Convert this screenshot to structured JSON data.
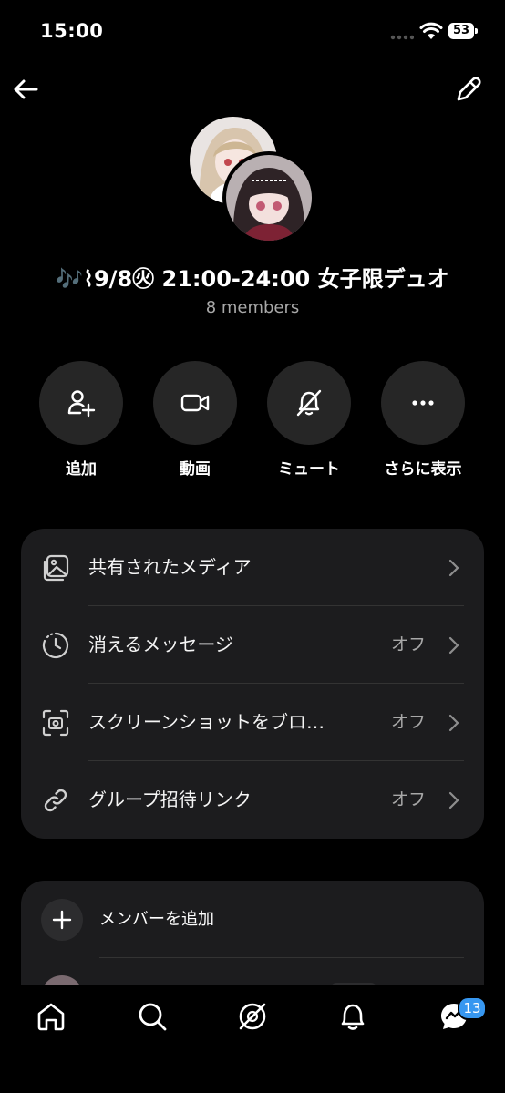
{
  "status_bar": {
    "time": "15:00",
    "battery": "53"
  },
  "group": {
    "title": "🎶⌇9/8㊋ 21:00-24:00 女子限デュオ",
    "members": "8 members"
  },
  "actions": [
    {
      "label": "追加",
      "icon": "add-person-icon"
    },
    {
      "label": "動画",
      "icon": "video-camera-icon"
    },
    {
      "label": "ミュート",
      "icon": "bell-muted-icon"
    },
    {
      "label": "さらに表示",
      "icon": "more-icon"
    }
  ],
  "settings": [
    {
      "label": "共有されたメディア",
      "value": "",
      "icon": "media-icon"
    },
    {
      "label": "消えるメッセージ",
      "value": "オフ",
      "icon": "timer-icon"
    },
    {
      "label": "スクリーンショットをブロ…",
      "value": "オフ",
      "icon": "screenshot-icon"
    },
    {
      "label": "グループ招待リンク",
      "value": "オフ",
      "icon": "link-icon"
    }
  ],
  "members_section": {
    "add_label": "メンバーを追加"
  },
  "tabbar": {
    "items": [
      "home-icon",
      "search-icon",
      "explore-icon",
      "notifications-icon",
      "messages-icon"
    ],
    "messages_badge": "13"
  },
  "colors": {
    "background": "#000000",
    "card": "#1c1c1e",
    "button": "#262626",
    "badge": "#3797f0",
    "muted_text": "#a8a8a8"
  }
}
